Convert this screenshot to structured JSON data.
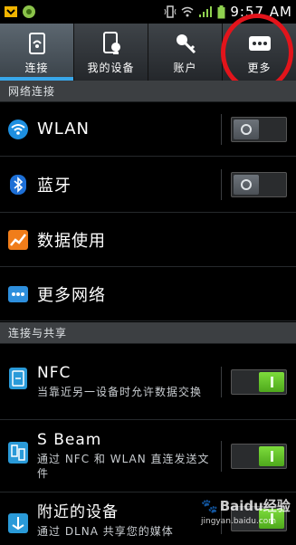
{
  "status_bar": {
    "time": "9:57 AM",
    "notification_icons": [
      "android-debug-icon",
      "app-notification-icon"
    ],
    "system_icons": [
      "vibrate-icon",
      "wifi-icon",
      "signal-icon",
      "battery-icon"
    ]
  },
  "tabs": [
    {
      "label": "连接",
      "icon": "connection-icon",
      "active": true
    },
    {
      "label": "我的设备",
      "icon": "device-icon",
      "active": false
    },
    {
      "label": "账户",
      "icon": "key-icon",
      "active": false
    },
    {
      "label": "更多",
      "icon": "more-dots-icon",
      "active": false
    }
  ],
  "sections": [
    {
      "title": "网络连接"
    },
    {
      "title": "连接与共享"
    }
  ],
  "rows": [
    {
      "label": "WLAN",
      "icon": "wifi-icon",
      "toggle": "off"
    },
    {
      "label": "蓝牙",
      "icon": "bluetooth-icon",
      "toggle": "off"
    },
    {
      "label": "数据使用",
      "icon": "data-usage-icon"
    },
    {
      "label": "更多网络",
      "icon": "more-networks-icon"
    },
    {
      "label": "NFC",
      "sub": "当靠近另一设备时允许数据交换",
      "icon": "nfc-icon",
      "toggle": "on"
    },
    {
      "label": "S Beam",
      "sub": "通过 NFC 和 WLAN 直连发送文件",
      "icon": "sbeam-icon",
      "toggle": "on"
    },
    {
      "label": "附近的设备",
      "sub": "通过 DLNA 共享您的媒体",
      "icon": "nearby-devices-icon",
      "toggle": "on"
    }
  ],
  "watermark": {
    "brand": "Baidu经验",
    "url": "jingyan.baidu.com"
  },
  "colors": {
    "accent_blue": "#38a7ea",
    "toggle_on": "#5cc12a",
    "highlight_red": "#e3141b"
  }
}
